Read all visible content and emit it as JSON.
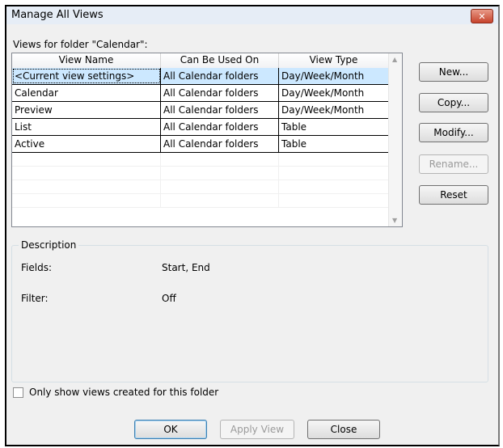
{
  "title": "Manage All Views",
  "close_glyph": "✕",
  "views_label": "Views for folder \"Calendar\":",
  "columns": [
    "View Name",
    "Can Be Used On",
    "View Type"
  ],
  "rows": [
    [
      "<Current view settings>",
      "All Calendar folders",
      "Day/Week/Month"
    ],
    [
      "Calendar",
      "All Calendar folders",
      "Day/Week/Month"
    ],
    [
      "Preview",
      "All Calendar folders",
      "Day/Week/Month"
    ],
    [
      "List",
      "All Calendar folders",
      "Table"
    ],
    [
      "Active",
      "All Calendar folders",
      "Table"
    ]
  ],
  "selected_row": 0,
  "buttons": {
    "new": "New...",
    "copy": "Copy...",
    "modify": "Modify...",
    "rename": "Rename...",
    "reset": "Reset"
  },
  "description": {
    "title": "Description",
    "fields_label": "Fields:",
    "fields_value": "Start, End",
    "filter_label": "Filter:",
    "filter_value": "Off"
  },
  "checkbox": {
    "label": "Only show views created for this folder",
    "checked": false
  },
  "footer": {
    "ok": "OK",
    "apply": "Apply View",
    "close": "Close"
  },
  "colors": {
    "selection": "#cce8ff",
    "titlebar": "#e6edf6",
    "close_button": "#c7432b"
  }
}
